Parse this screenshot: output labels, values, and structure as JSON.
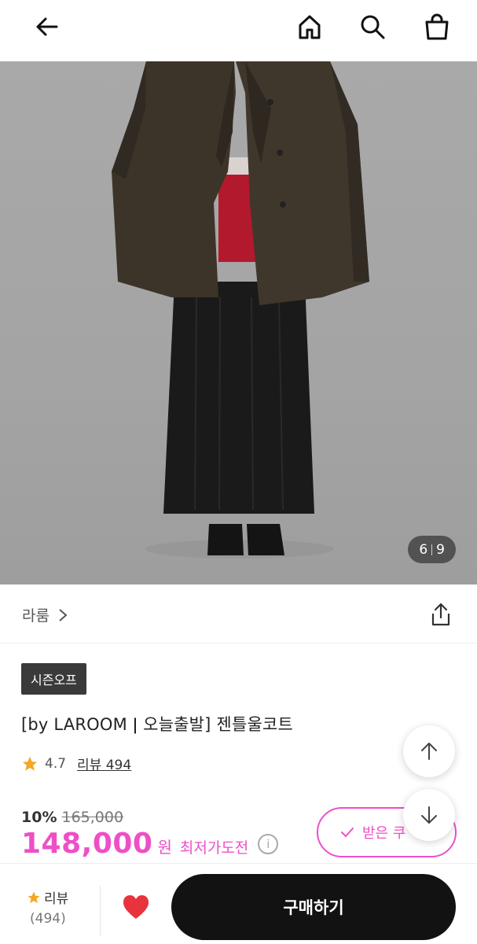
{
  "header": {
    "back_icon": "arrow-left-icon",
    "home_icon": "home-icon",
    "search_icon": "search-icon",
    "cart_icon": "shopping-bag-icon"
  },
  "gallery": {
    "current": "6",
    "total": "9"
  },
  "brand": {
    "name": "라룸",
    "chevron": "›",
    "share_icon": "share-icon"
  },
  "product": {
    "badge": "시즌오프",
    "title": "[by LAROOM ǀ 오늘출발] 젠틀울코트",
    "rating": "4.7",
    "review_link": "리뷰 494",
    "discount": "10%",
    "original_price": "165,000",
    "price": "148,000",
    "currency": "원",
    "lowest_label": "최저가도전",
    "info_glyph": "i",
    "coupon_label": "받은 쿠"
  },
  "bottom_bar": {
    "review_label": "리뷰",
    "review_count": "(494)",
    "buy_label": "구매하기"
  },
  "colors": {
    "accent": "#ee4fc7",
    "buy_button": "#121212",
    "heart": "#e8323c",
    "star": "#f5a623"
  }
}
